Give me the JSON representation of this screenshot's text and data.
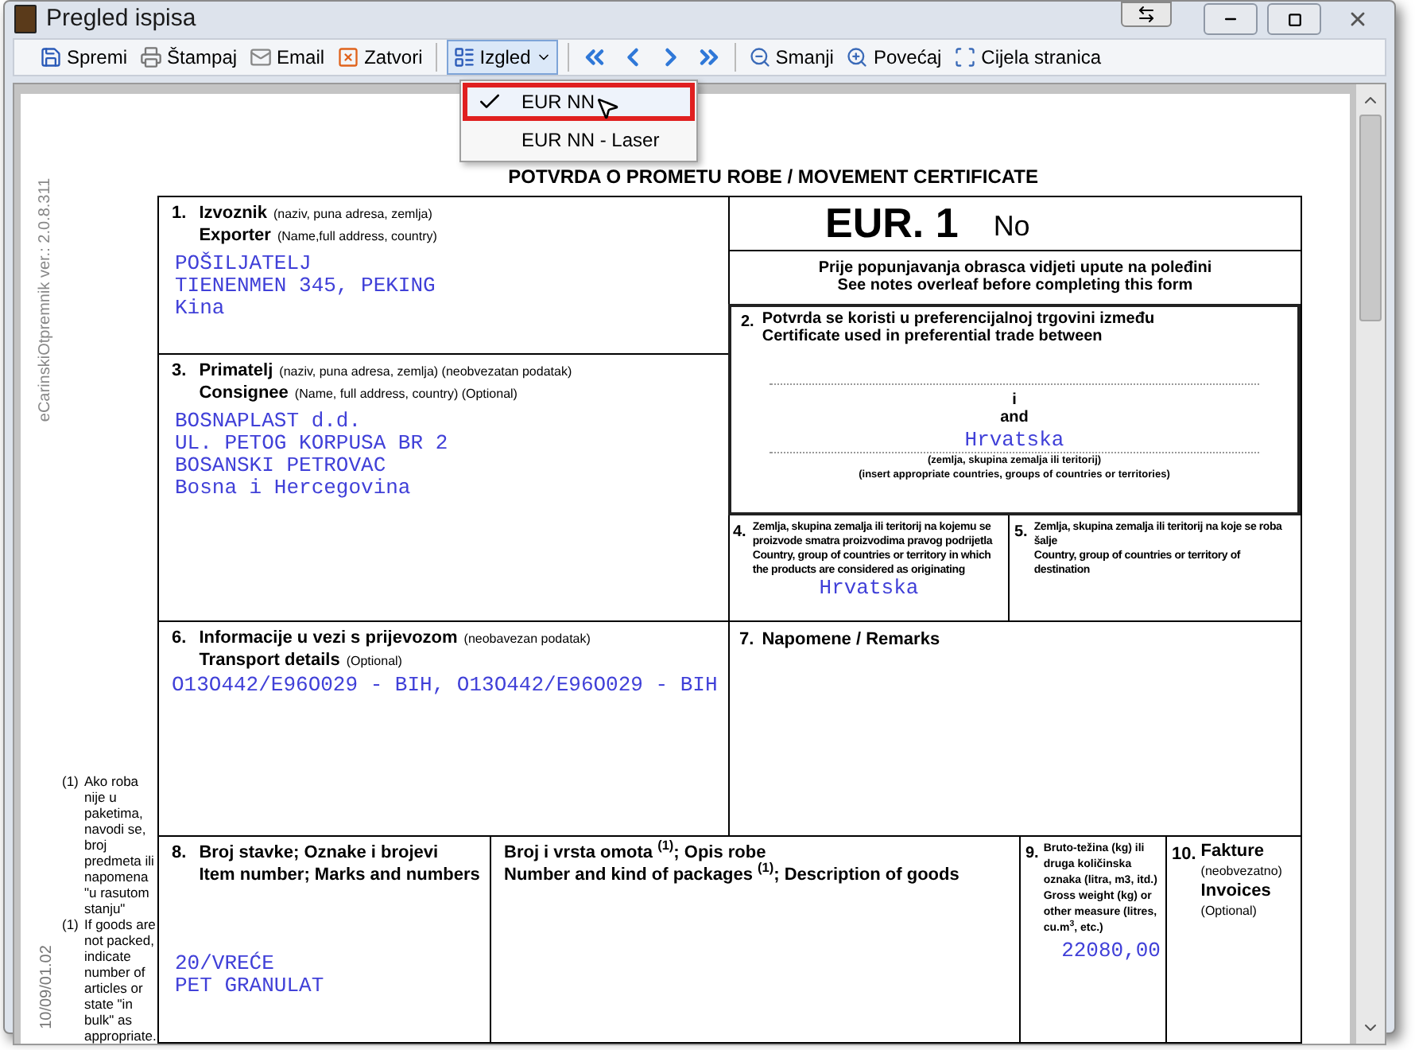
{
  "window": {
    "title": "Pregled ispisa"
  },
  "toolbar": {
    "actions": [
      {
        "label": "Spremi"
      },
      {
        "label": "Štampaj"
      },
      {
        "label": "Email"
      },
      {
        "label": "Zatvori"
      }
    ],
    "layout": {
      "label": "Izgled",
      "expanded": true
    },
    "zoom": [
      {
        "label": "Smanji"
      },
      {
        "label": "Povećaj"
      },
      {
        "label": "Cijela stranica"
      }
    ]
  },
  "layout_menu": [
    {
      "label": "EUR NN",
      "selected": true
    },
    {
      "label": "EUR NN - Laser",
      "selected": false
    }
  ],
  "document": {
    "side_version": "eCarinskiOtpremnik ver.: 2.0.8.311",
    "side_code": "10/09/01.02",
    "footnotes": [
      {
        "marker": "(1)",
        "text": "Ako roba nije u paketima, navodi se, broj predmeta ili napomena \"u rasutom stanju\""
      },
      {
        "marker": "(1)",
        "text": "If goods are not packed, indicate number of articles or state \"in bulk\" as appropriate."
      }
    ],
    "title": "POTVRDA O PROMETU ROBE / MOVEMENT CERTIFICATE",
    "box1": {
      "number": "1.",
      "label_hr": "Izvoznik",
      "note_hr": "(naziv, puna adresa, zemlja)",
      "label_en": "Exporter",
      "note_en": "(Name,full address, country)",
      "value": [
        "POŠILJATELJ",
        "TIENENMEN 345, PEKING",
        "Kina"
      ]
    },
    "box3": {
      "number": "3.",
      "label_hr": "Primatelj",
      "note_hr": "(naziv, puna adresa, zemlja) (neobvezatan podatak)",
      "label_en": "Consignee",
      "note_en": "(Name, full address, country) (Optional)",
      "value": [
        "BOSNAPLAST d.d.",
        "UL. PETOG KORPUSA BR 2",
        "BOSANSKI PETROVAC",
        "Bosna i Hercegovina"
      ]
    },
    "eur": {
      "title": "EUR. 1",
      "no": "No"
    },
    "notes": [
      "Prije popunjavanja obrasca vidjeti upute na poleđini",
      "See notes overleaf before completing this form"
    ],
    "box2": {
      "number": "2.",
      "label_hr": "Potvrda se koristi u preferencijalnoj trgovini između",
      "label_en": "Certificate used in preferential trade between",
      "and_hr": "i",
      "and_en": "and",
      "value": "Hrvatska",
      "hint_hr": "(zemlja, skupina zemalja ili teritorij)",
      "hint_en": "(insert appropriate countries, groups of countries or territories)"
    },
    "box4": {
      "number": "4.",
      "label_hr": "Zemlja, skupina zemalja ili teritorij na kojemu se proizvode smatra proizvodima pravog podrijetla",
      "label_en": "Country, group of countries or territory in which the products are considered as originating",
      "value": "Hrvatska"
    },
    "box5": {
      "number": "5.",
      "label_hr": "Zemlja, skupina zemalja ili teritorij na koje se roba šalje",
      "label_en": "Country, group of countries or territory of destination"
    },
    "box6": {
      "number": "6.",
      "label_hr": "Informacije u vezi s prijevozom",
      "note_hr": "(neobavezan podatak)",
      "label_en": "Transport details",
      "note_en": "(Optional)",
      "value": "O13O442/E96O029 - BIH, O13O442/E96O029 - BIH"
    },
    "box7": {
      "number": "7.",
      "label": "Napomene / Remarks"
    },
    "box8": {
      "number": "8.",
      "label_hr": "Broj stavke; Oznake i brojevi",
      "label_en": "Item number; Marks and numbers",
      "value": [
        "20/VREĆE",
        "PET GRANULAT"
      ]
    },
    "goods": {
      "label_hr": "Broj i vrsta omota $^{(1)}$; Opis robe",
      "label_en": "Number and kind of packages $^{(1)}$; Description of goods"
    },
    "box9": {
      "number": "9.",
      "label": "Bruto-težina (kg) ili druga količinska oznaka (litra, m3, itd.) Gross weight (kg) or other measure (litres, cu.m$^{3}$, etc.)",
      "value": "22080,00"
    },
    "box10": {
      "number": "10.",
      "label_hr": "Fakture",
      "note_hr": "(neobvezatno)",
      "label_en": "Invoices",
      "note_en": "(Optional)"
    }
  }
}
